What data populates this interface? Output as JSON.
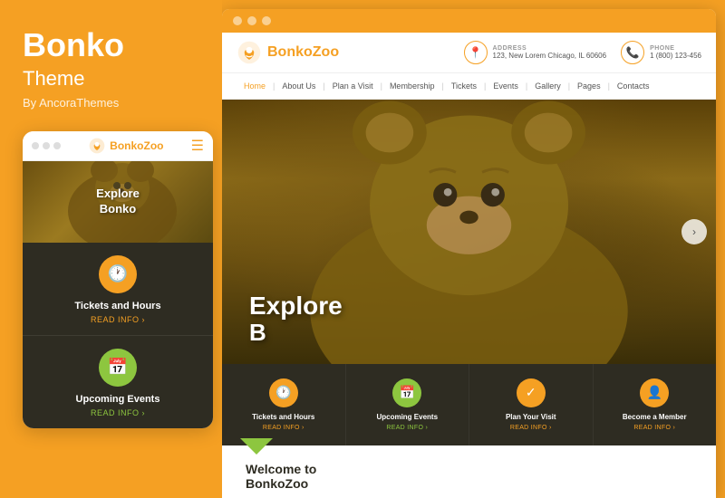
{
  "left": {
    "title": "Bonko",
    "subtitle": "Theme",
    "by": "By AncoraThemes",
    "mobile": {
      "dots": [
        "dot1",
        "dot2",
        "dot3"
      ],
      "logo_text_part1": "Bonko",
      "logo_text_part2": "Zoo",
      "hero_text_line1": "Explore",
      "hero_text_line2": "Bonko",
      "feature1": {
        "title": "Tickets and Hours",
        "link": "READ INFO ›",
        "icon": "🕐"
      },
      "feature2": {
        "title": "Upcoming Events",
        "link": "READ INFO ›",
        "icon": "📅"
      }
    }
  },
  "right": {
    "titlebar_dots": [
      "dot1",
      "dot2",
      "dot3"
    ],
    "logo_text_part1": "Bonko",
    "logo_text_part2": "Zoo",
    "address_label": "ADDRESS",
    "address_value": "123, New Lorem Chicago, IL 60606",
    "phone_label": "PHONE",
    "phone_value": "1 (800) 123-456",
    "nav": [
      "Home",
      "About Us",
      "Plan a Visit",
      "Membership",
      "Tickets",
      "Events",
      "Gallery",
      "Pages",
      "Contacts"
    ],
    "hero_text_line1": "Explore",
    "hero_text_line2": "B",
    "features": [
      {
        "title": "Tickets and Hours",
        "link": "READ INFO ›",
        "icon": "🕐",
        "color": "orange"
      },
      {
        "title": "Upcoming Events",
        "link": "READ INFO ›",
        "icon": "📅",
        "color": "green"
      },
      {
        "title": "Plan Your Visit",
        "link": "READ INFO ›",
        "icon": "✓",
        "color": "orange"
      },
      {
        "title": "Become a Member",
        "link": "READ INFO ›",
        "icon": "👤",
        "color": "orange"
      }
    ],
    "welcome_title": "Welcome to",
    "welcome_subtitle": "BonkoZoo"
  }
}
